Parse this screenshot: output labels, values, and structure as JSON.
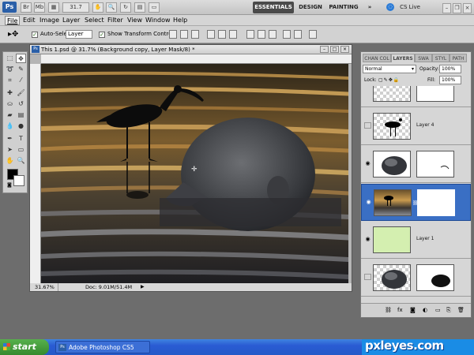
{
  "app": {
    "logo": "Ps",
    "zoom": "31.7",
    "workspaces": [
      "ESSENTIALS",
      "DESIGN",
      "PAINTING"
    ],
    "more": "»",
    "cslive": "CS Live"
  },
  "menus": [
    "File",
    "Edit",
    "Image",
    "Layer",
    "Select",
    "Filter",
    "View",
    "Window",
    "Help"
  ],
  "options": {
    "auto_select_label": "Auto-Select:",
    "auto_select_value": "Layer",
    "transform_label": "Show Transform Controls"
  },
  "document": {
    "title": "This 1.psd @ 31.7% (Background copy, Layer Mask/8) *",
    "zoom_status": "31.67%",
    "doc_status": "Doc: 9.01M/51.4M"
  },
  "panels": {
    "tabs": [
      "CHAN COL",
      "LAYERS",
      "SWA",
      "STYL",
      "PATH"
    ],
    "blend_mode": "Normal",
    "opacity_label": "Opacity:",
    "opacity_value": "100%",
    "lock_label": "Lock:",
    "fill_label": "Fill:",
    "fill_value": "100%",
    "layers": [
      {
        "name": "",
        "visible": false
      },
      {
        "name": "Layer 4",
        "visible": false
      },
      {
        "name": "",
        "visible": true
      },
      {
        "name": "",
        "visible": true,
        "selected": true
      },
      {
        "name": "Layer 1",
        "visible": true
      },
      {
        "name": "",
        "visible": false
      }
    ]
  },
  "taskbar": {
    "start": "start",
    "item": "Adobe Photoshop CS5",
    "watermark": "pxleyes.com"
  },
  "colors": {
    "selection": "#3a6fc4",
    "layer1_fill": "#d4efb0",
    "taskbar": "#2a5bd3"
  }
}
